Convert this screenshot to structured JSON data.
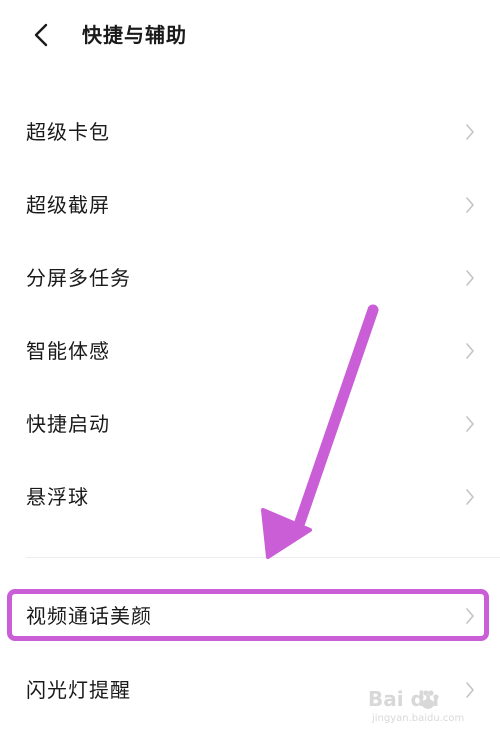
{
  "header": {
    "title": "快捷与辅助",
    "back_icon": "chevron-left-icon"
  },
  "settings": {
    "items": [
      {
        "label": "超级卡包"
      },
      {
        "label": "超级截屏"
      },
      {
        "label": "分屏多任务"
      },
      {
        "label": "智能体感"
      },
      {
        "label": "快捷启动"
      },
      {
        "label": "悬浮球"
      },
      {
        "label": "视频通话美颜"
      },
      {
        "label": "闪光灯提醒"
      }
    ]
  },
  "annotation": {
    "highlight_color": "#c95ed6",
    "arrow_color": "#c95ed6"
  },
  "watermark": {
    "logo": "Bai du",
    "url": "jingyan.baidu.com"
  }
}
